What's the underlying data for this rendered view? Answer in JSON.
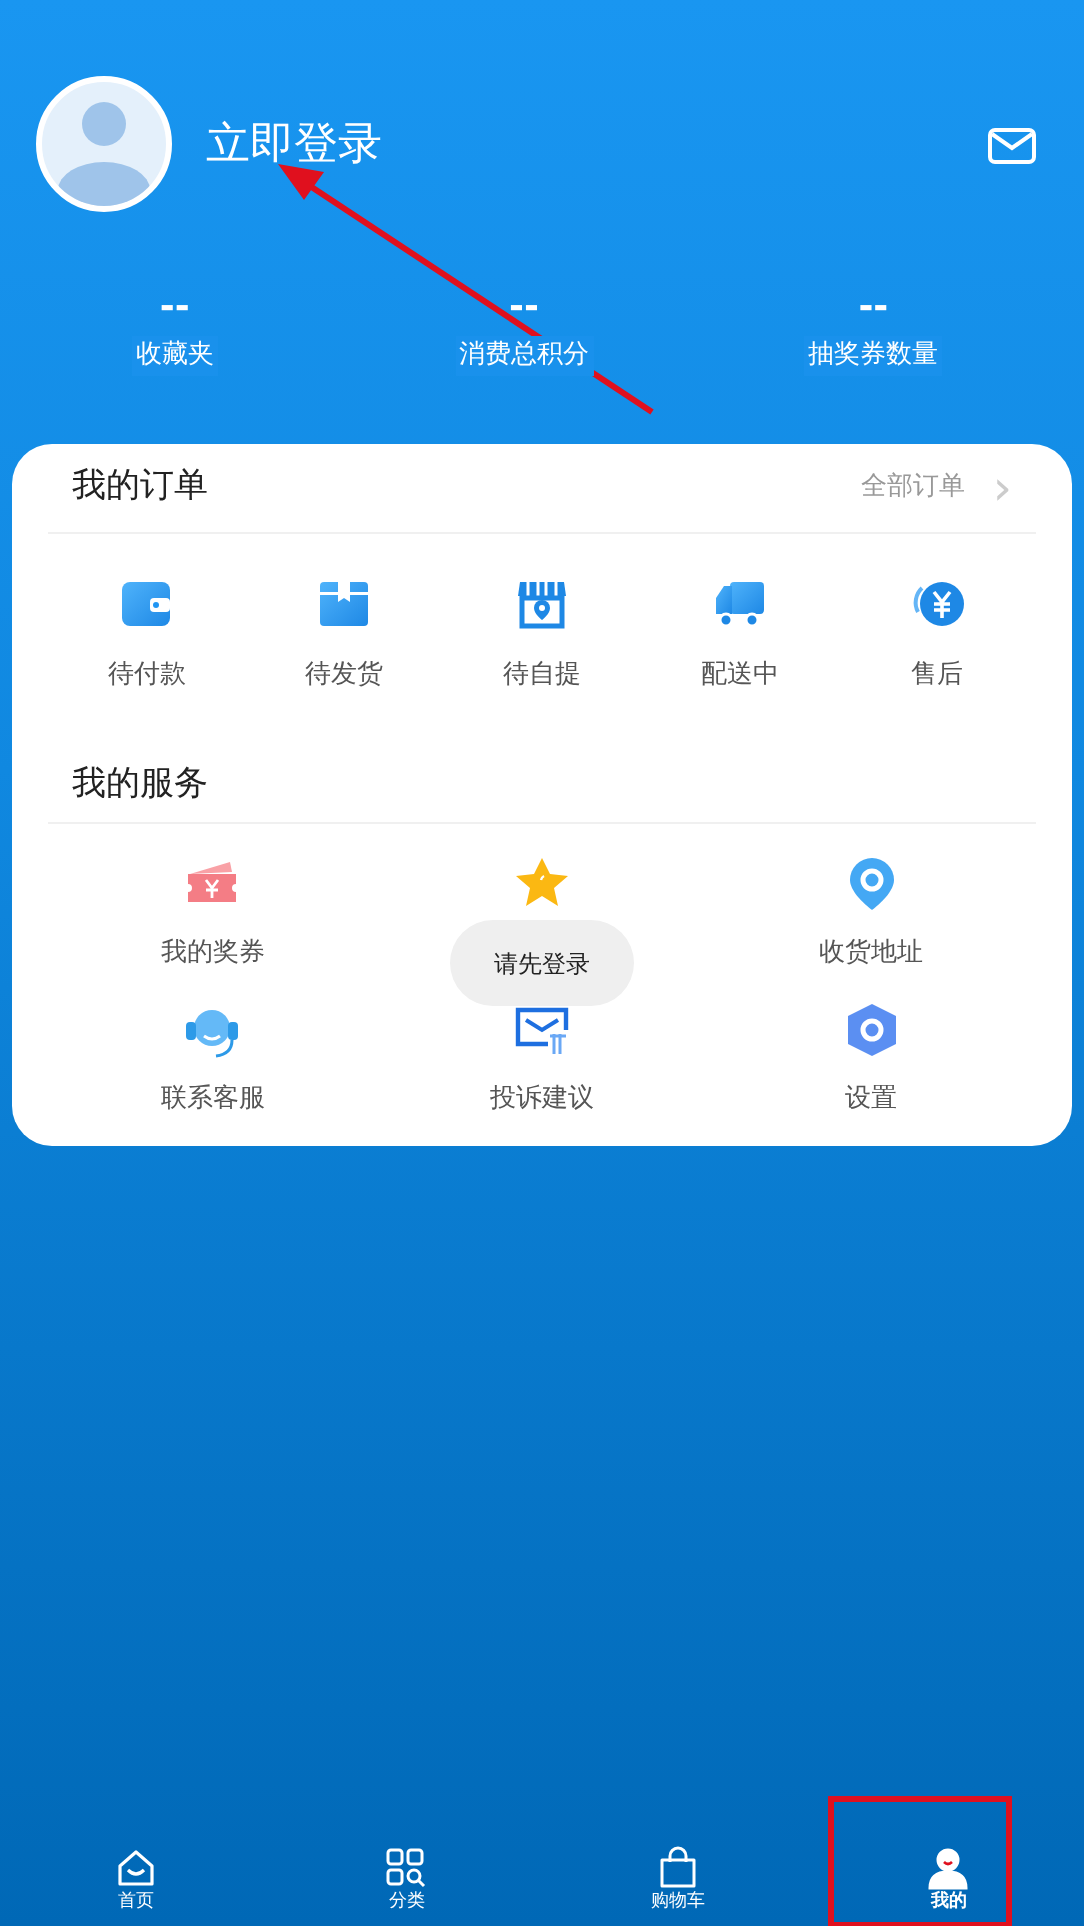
{
  "profile": {
    "login_text": "立即登录"
  },
  "stats": [
    {
      "value": "--",
      "label": "收藏夹"
    },
    {
      "value": "--",
      "label": "消费总积分"
    },
    {
      "value": "--",
      "label": "抽奖券数量"
    }
  ],
  "orders": {
    "title": "我的订单",
    "all_link": "全部订单",
    "chevron": "›",
    "items": [
      {
        "label": "待付款"
      },
      {
        "label": "待发货"
      },
      {
        "label": "待自提"
      },
      {
        "label": "配送中"
      },
      {
        "label": "售后"
      }
    ]
  },
  "services": {
    "title": "我的服务",
    "items": [
      {
        "kind": "labeled",
        "label": "我的奖券"
      },
      {
        "kind": "icon_only"
      },
      {
        "kind": "labeled",
        "label": "收货地址"
      },
      {
        "kind": "labeled",
        "label": "联系客服"
      },
      {
        "kind": "labeled",
        "label": "投诉建议"
      },
      {
        "kind": "labeled",
        "label": "设置"
      }
    ]
  },
  "toast": "请先登录",
  "tabbar": [
    {
      "label": "首页",
      "selected": false
    },
    {
      "label": "分类",
      "selected": false
    },
    {
      "label": "购物车",
      "selected": false
    },
    {
      "label": "我的",
      "selected": true
    }
  ],
  "annotations": {
    "arrow": true,
    "highlight_box": true
  }
}
